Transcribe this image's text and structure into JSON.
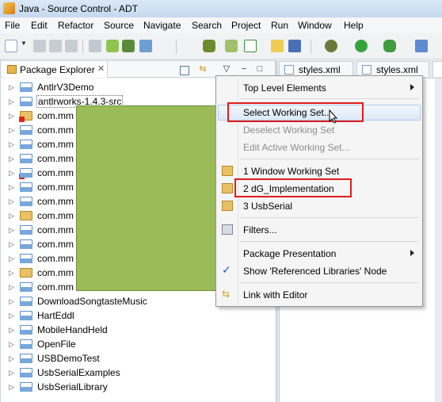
{
  "window": {
    "title": "Java - Source Control - ADT"
  },
  "menubar": [
    "File",
    "Edit",
    "Refactor",
    "Source",
    "Navigate",
    "Search",
    "Project",
    "Run",
    "Window",
    "Help"
  ],
  "explorer": {
    "tab_label": "Package Explorer",
    "tab_close": "✕",
    "items": [
      {
        "label": "AntlrV3Demo",
        "icon": "java-project-icon",
        "error": false
      },
      {
        "label": "antlrworks-1.4.3-src",
        "icon": "java-project-icon",
        "error": false,
        "selected": true
      },
      {
        "label": "com.mm",
        "icon": "folder-icon",
        "error": true
      },
      {
        "label": "com.mm",
        "icon": "open-project-icon",
        "error": false
      },
      {
        "label": "com.mm",
        "icon": "open-project-icon",
        "error": false
      },
      {
        "label": "com.mm",
        "icon": "open-project-icon",
        "error": false
      },
      {
        "label": "com.mm",
        "icon": "open-project-icon",
        "error": true
      },
      {
        "label": "com.mm",
        "icon": "open-project-icon",
        "error": false
      },
      {
        "label": "com.mm",
        "icon": "open-project-icon",
        "error": false
      },
      {
        "label": "com.mm",
        "icon": "folder-icon",
        "error": false
      },
      {
        "label": "com.mm",
        "icon": "open-project-icon",
        "error": false
      },
      {
        "label": "com.mm",
        "icon": "open-project-icon",
        "error": false
      },
      {
        "label": "com.mm",
        "icon": "open-project-icon",
        "error": false
      },
      {
        "label": "com.mm",
        "icon": "folder-icon",
        "error": false
      },
      {
        "label": "com.mm",
        "icon": "open-project-icon",
        "error": false
      },
      {
        "label": "DownloadSongtasteMusic",
        "icon": "java-project-icon",
        "error": false
      },
      {
        "label": "HartEddl",
        "icon": "java-project-icon",
        "error": false
      },
      {
        "label": "MobileHandHeld",
        "icon": "java-project-icon",
        "error": false
      },
      {
        "label": "OpenFile",
        "icon": "java-project-icon",
        "error": false
      },
      {
        "label": "USBDemoTest",
        "icon": "java-project-icon",
        "error": false
      },
      {
        "label": "UsbSerialExamples",
        "icon": "java-project-icon",
        "error": false
      },
      {
        "label": "UsbSerialLibrary",
        "icon": "java-project-icon",
        "error": false
      }
    ]
  },
  "editor_tabs": [
    {
      "label": "styles.xml"
    },
    {
      "label": "styles.xml"
    }
  ],
  "view_menu": {
    "items": [
      {
        "label": "Top Level Elements",
        "submenu": true,
        "enabled": true
      },
      {
        "label": "Select Working Set...",
        "enabled": true,
        "highlighted": true
      },
      {
        "label": "Deselect Working Set",
        "enabled": false
      },
      {
        "label": "Edit Active Working Set...",
        "enabled": false
      },
      {
        "label": "1 Window Working Set",
        "enabled": true,
        "icon": "working-set-icon"
      },
      {
        "label": "2 dG_Implementation",
        "enabled": true,
        "icon": "working-set-icon"
      },
      {
        "label": "3 UsbSerial",
        "enabled": true,
        "icon": "working-set-icon"
      },
      {
        "label": "Filters...",
        "enabled": true,
        "icon": "filter-icon"
      },
      {
        "label": "Package Presentation",
        "submenu": true,
        "enabled": true
      },
      {
        "label": "Show 'Referenced Libraries' Node",
        "enabled": true,
        "checked": true
      },
      {
        "label": "Link with Editor",
        "enabled": true,
        "icon": "link-icon"
      }
    ]
  },
  "colors": {
    "highlight_box": "#e01b1b",
    "redaction": "#9bbb59"
  }
}
